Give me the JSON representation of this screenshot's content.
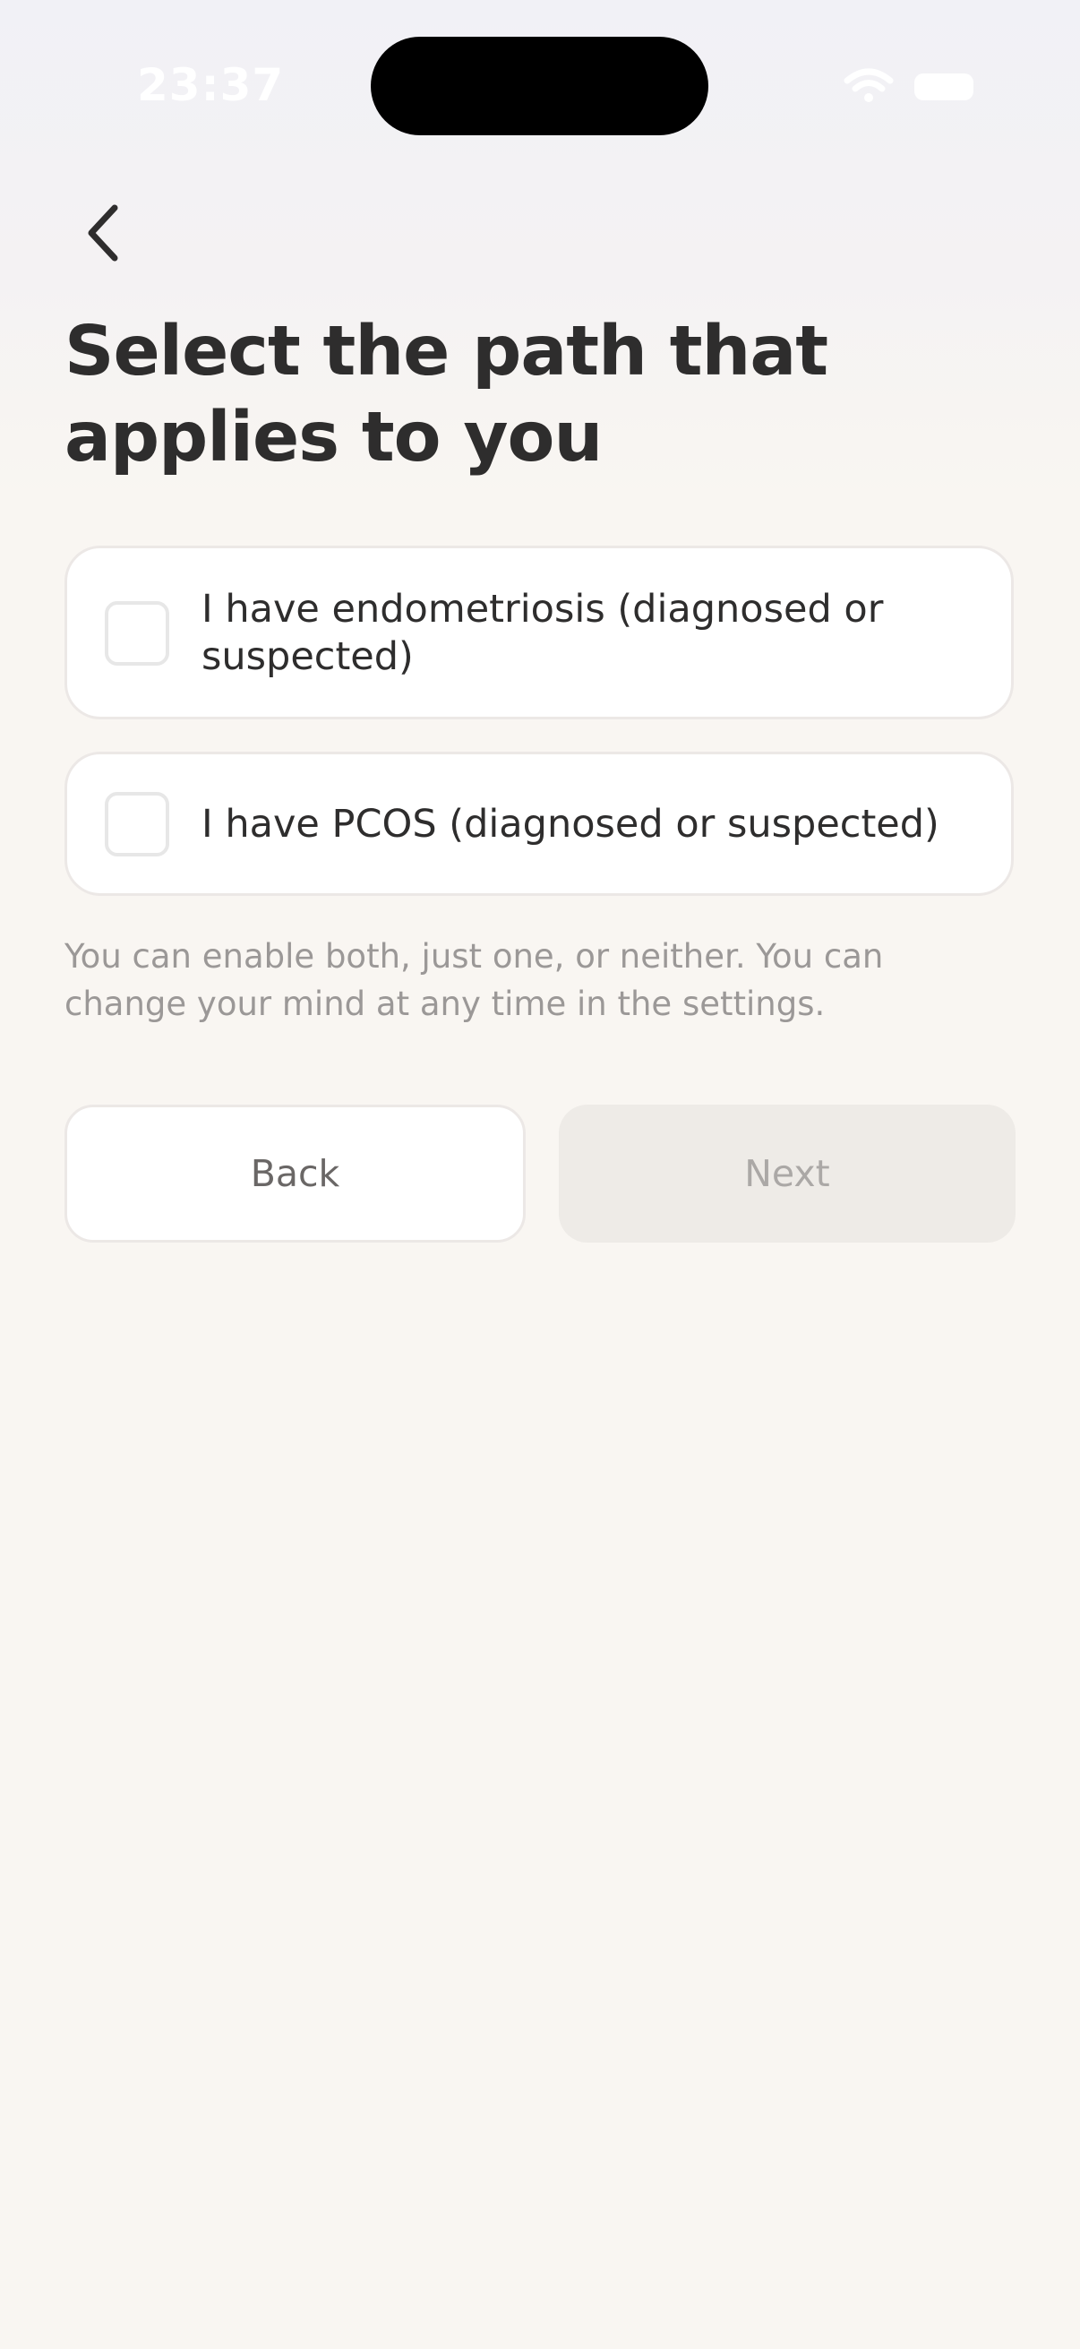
{
  "status_bar": {
    "time": "23:37"
  },
  "header": {
    "back_icon": "chevron-left-icon",
    "title": "Select the path that applies to you"
  },
  "options": [
    {
      "label": "I have endometriosis (diagnosed or suspected)",
      "checked": false
    },
    {
      "label": "I have PCOS (diagnosed or suspected)",
      "checked": false
    }
  ],
  "hint": "You can enable both, just one, or neither. You can change your mind at any time in the settings.",
  "buttons": {
    "back_label": "Back",
    "next_label": "Next",
    "next_enabled": false
  },
  "colors": {
    "title_text": "#2e2d2d",
    "body_text": "#2e2d2d",
    "hint_text": "#9b9897",
    "background": "#f9f6f2",
    "card_border": "#ece8e6",
    "disabled_button_bg": "#eeebe7",
    "disabled_button_text": "#aba8a6"
  }
}
